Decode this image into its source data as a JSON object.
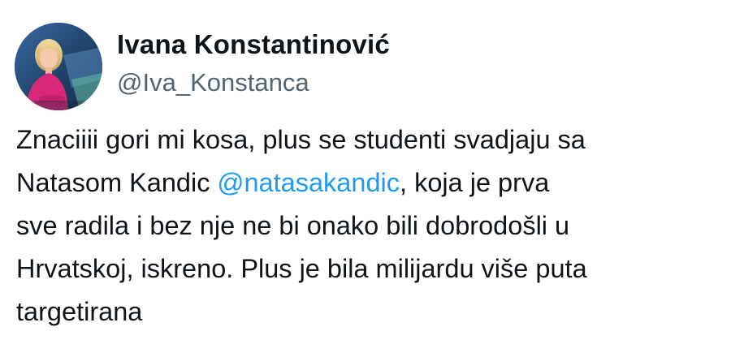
{
  "tweet": {
    "author": {
      "display_name": "Ivana Konstantinović",
      "handle": "@Iva_Konstanca",
      "avatar_icon": "profile-photo"
    },
    "text_lines": [
      [
        "Znaciiii gori mi kosa, plus se studenti svadjaju sa"
      ],
      [
        "Natasom Kandic ",
        "@natasakandic",
        ", koja je prva"
      ],
      [
        "sve radila i bez nje ne bi onako bili dobrodošli u"
      ],
      [
        "Hrvatskoj, iskreno. Plus je bila milijardu više puta"
      ],
      [
        "targetirana"
      ]
    ],
    "mention_color": "#1d9bf0",
    "handle_color": "#536471"
  }
}
